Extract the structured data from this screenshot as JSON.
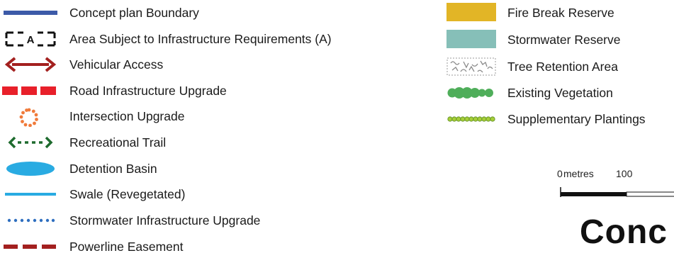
{
  "legend_left": [
    {
      "label": "Concept plan Boundary",
      "symbol": "blue-line-icon",
      "color": "#3c5aa8"
    },
    {
      "label": "Area Subject to Infrastructure Requirements (A)",
      "symbol": "dashed-box-a-icon",
      "box_letter": "A",
      "color": "#111111"
    },
    {
      "label": "Vehicular Access",
      "symbol": "double-arrow-icon",
      "color": "#a3201f"
    },
    {
      "label": "Road Infrastructure Upgrade",
      "symbol": "red-dash-bar-icon",
      "color": "#e8202a"
    },
    {
      "label": "Intersection Upgrade",
      "symbol": "dotted-ring-icon",
      "color": "#f07a3a"
    },
    {
      "label": "Recreational Trail",
      "symbol": "green-dashed-arrow-icon",
      "color": "#1e6b2e"
    },
    {
      "label": "Detention Basin",
      "symbol": "blue-ellipse-icon",
      "color": "#29abe2"
    },
    {
      "label": "Swale (Revegetated)",
      "symbol": "light-blue-line-icon",
      "color": "#29abe2"
    },
    {
      "label": "Stormwater Infrastructure Upgrade",
      "symbol": "blue-dotted-line-icon",
      "color": "#2f6fc0"
    },
    {
      "label": "Powerline Easement",
      "symbol": "dark-red-dash-icon",
      "color": "#a3201f"
    }
  ],
  "legend_right": [
    {
      "label": "Fire Break Reserve",
      "symbol": "yellow-swatch-icon",
      "color": "#e2b526"
    },
    {
      "label": "Stormwater Reserve",
      "symbol": "teal-swatch-icon",
      "color": "#86bfb8"
    },
    {
      "label": "Tree Retention Area",
      "symbol": "tree-pattern-swatch-icon",
      "color": "#8a8a8a"
    },
    {
      "label": "Existing Vegetation",
      "symbol": "green-circles-icon",
      "color": "#4fae5a"
    },
    {
      "label": "Supplementary Plantings",
      "symbol": "small-green-circles-icon",
      "color": "#a6ce39"
    }
  ],
  "scale": {
    "unit": "metres",
    "zero": "0",
    "tick": "100"
  },
  "title_fragment": "Conc"
}
